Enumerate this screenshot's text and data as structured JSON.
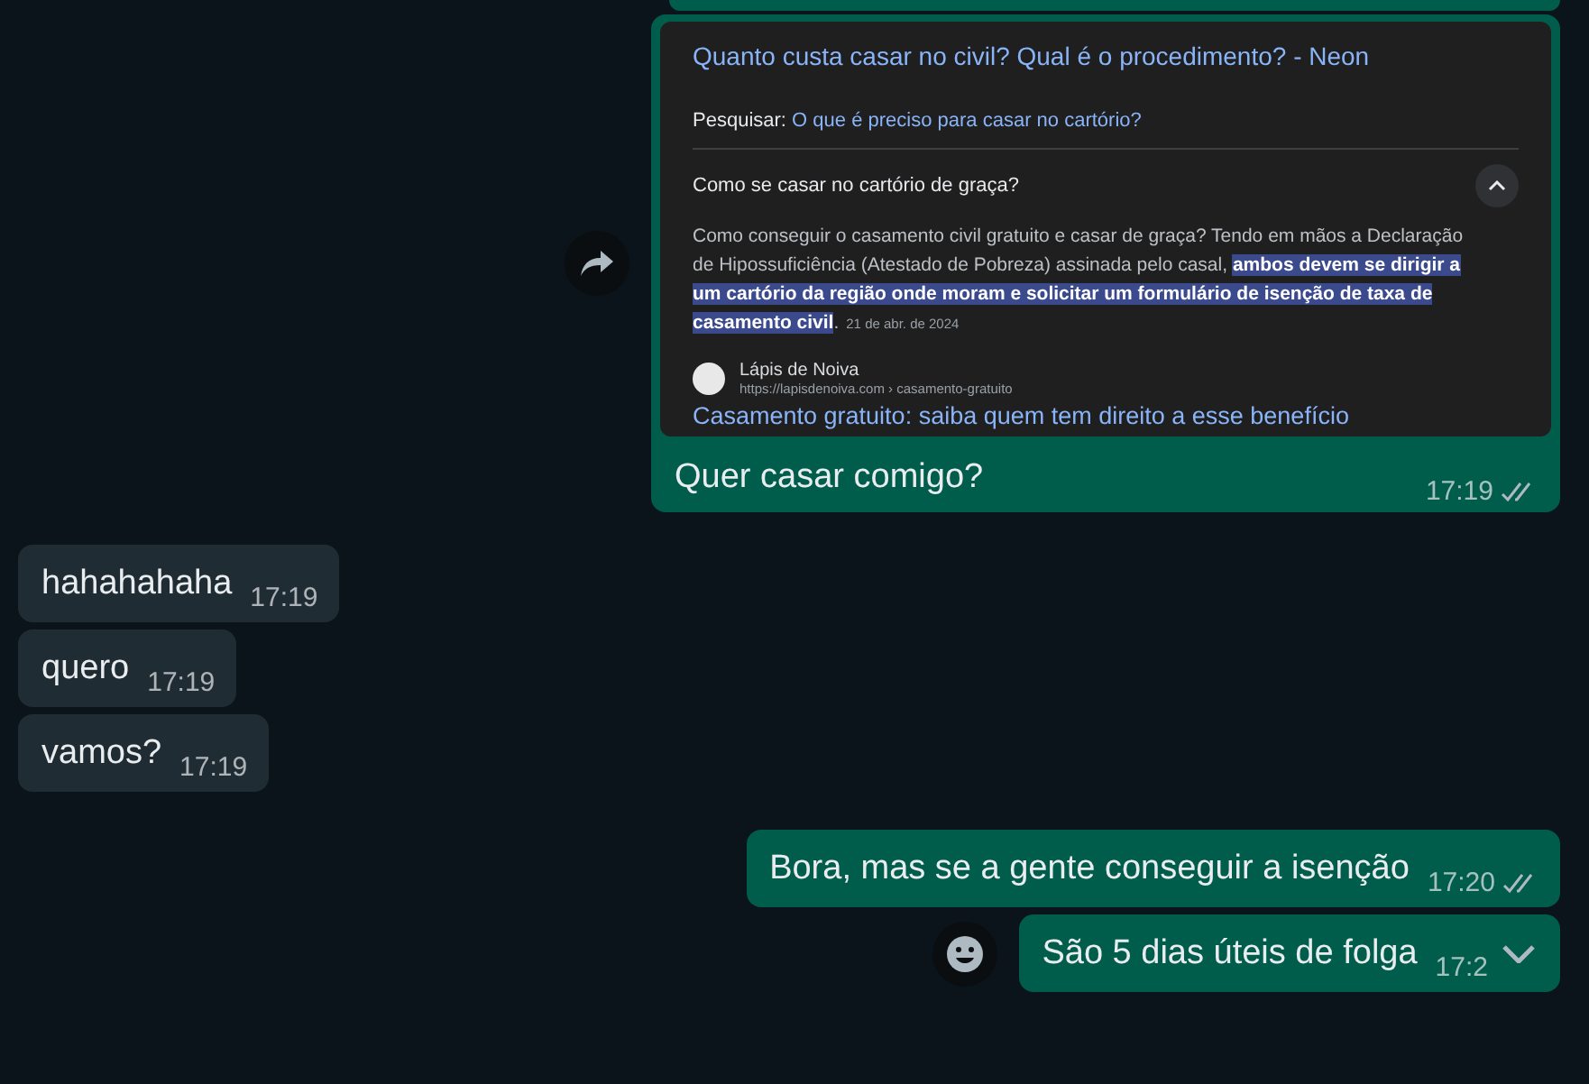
{
  "messages": [
    {
      "kind": "image",
      "incoming": false,
      "forward_button": true,
      "screenshot": {
        "result_title": "Quanto custa casar no civil? Qual é o procedimento? - Neon",
        "search_label": "Pesquisar:",
        "search_link": "O que é preciso para casar no cartório?",
        "question": "Como se casar no cartório de graça?",
        "expanded": true,
        "snippet": [
          {
            "text": "Como conseguir o casamento civil gratuito e casar de graça? Tendo em mãos a Declaração de Hipossuficiência (Atestado de Pobreza) assinada pelo casal, ",
            "highlighted": false
          },
          {
            "text": "ambos devem se dirigir a um cartório da região onde moram e solicitar um formulário de isenção de taxa de casamento civil",
            "highlighted": true
          },
          {
            "text": ".",
            "highlighted": false
          }
        ],
        "date": "21 de abr. de 2024",
        "source_name": "Lápis de Noiva",
        "source_url": "https://lapisdenoiva.com › casamento-gratuito",
        "source_title": "Casamento gratuito: saiba quem tem direito a esse benefício"
      },
      "text": "Quer casar comigo?",
      "time": "17:19",
      "read": false
    },
    {
      "kind": "text",
      "incoming": true,
      "text": "hahahahaha",
      "time": "17:19"
    },
    {
      "kind": "text",
      "incoming": true,
      "text": "quero",
      "time": "17:19"
    },
    {
      "kind": "text",
      "incoming": true,
      "text": "vamos?",
      "time": "17:19"
    },
    {
      "kind": "text",
      "incoming": false,
      "text": "Bora, mas se a gente conseguir a isenção",
      "time": "17:20",
      "read": false
    },
    {
      "kind": "text",
      "incoming": false,
      "text": "São 5 dias úteis de folga",
      "time": "17:2",
      "hovered": true
    }
  ]
}
